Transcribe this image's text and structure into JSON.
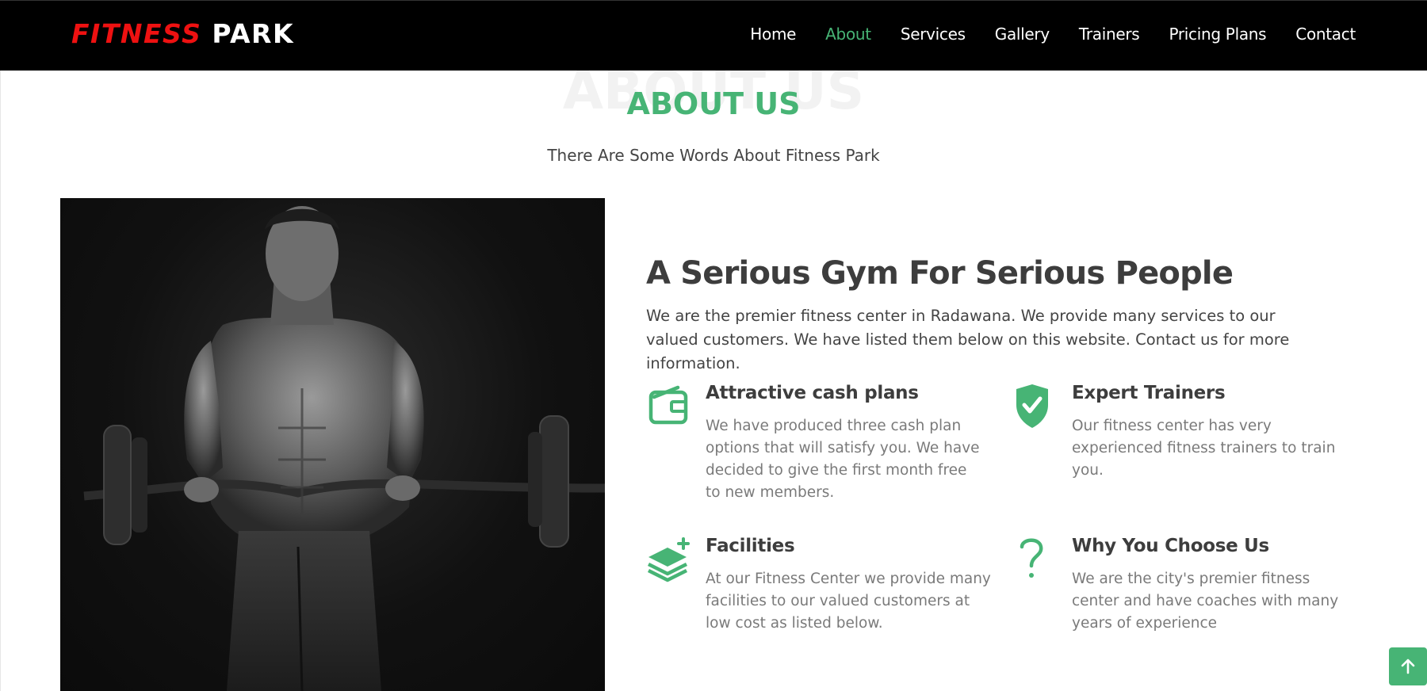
{
  "brand": {
    "part1": "FITNESS",
    "part2": "PARK"
  },
  "nav": {
    "items": [
      {
        "label": "Home"
      },
      {
        "label": "About"
      },
      {
        "label": "Services"
      },
      {
        "label": "Gallery"
      },
      {
        "label": "Trainers"
      },
      {
        "label": "Pricing Plans"
      },
      {
        "label": "Contact"
      }
    ],
    "active": "About"
  },
  "section": {
    "bg_title": "ABOUT US",
    "title": "ABOUT US",
    "subtitle": "There Are Some Words About Fitness Park"
  },
  "about": {
    "heading": "A Serious Gym For Serious People",
    "intro": "We are the premier fitness center in Radawana. We provide many services to our valued customers. We have listed them below on this website. Contact us for more information."
  },
  "features": [
    {
      "icon": "wallet-icon",
      "title": "Attractive cash plans",
      "text": "We have produced three cash plan options that will satisfy you. We have decided to give the first month free to new members."
    },
    {
      "icon": "shield-check-icon",
      "title": "Expert Trainers",
      "text": "Our fitness center has very experienced fitness trainers to train you."
    },
    {
      "icon": "layers-plus-icon",
      "title": "Facilities",
      "text": "At our Fitness Center we provide many facilities to our valued customers at low cost as listed below."
    },
    {
      "icon": "question-icon",
      "title": "Why You Choose Us",
      "text": "We are the city's premier fitness center and have coaches with many years of experience"
    }
  ],
  "colors": {
    "accent": "#47b475",
    "brand_red": "#ee1111",
    "navbar_bg": "#000000"
  },
  "back_to_top": {
    "icon": "arrow-up-icon"
  }
}
